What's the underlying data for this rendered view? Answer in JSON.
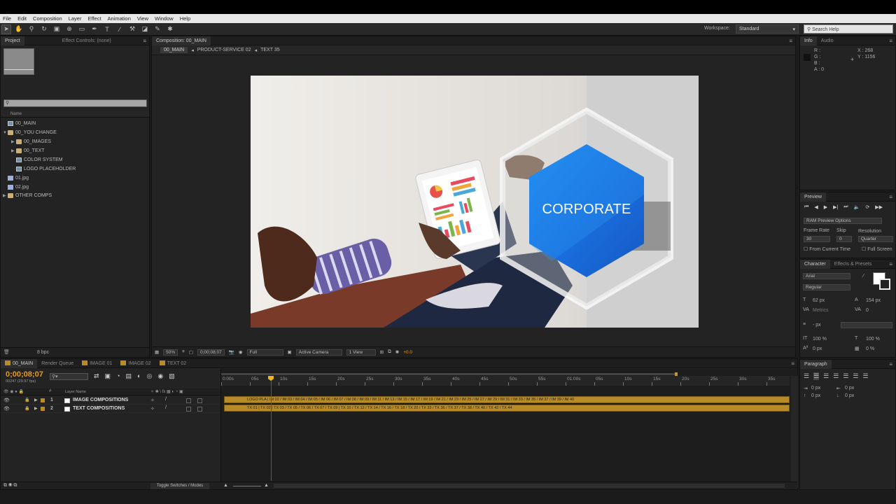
{
  "menu": [
    "File",
    "Edit",
    "Composition",
    "Layer",
    "Effect",
    "Animation",
    "View",
    "Window",
    "Help"
  ],
  "workspace": {
    "label": "Workspace:",
    "value": "Standard"
  },
  "search_help": "Search Help",
  "project": {
    "tabs": [
      "Project",
      "Effect Controls: (none)"
    ],
    "col_name": "Name",
    "items": [
      "00_MAIN",
      "00_YOU CHANGE",
      "00_IMAGES",
      "00_TEXT",
      "COLOR SYSTEM",
      "LOGO PLACEHOLDER",
      "01.jpg",
      "02.jpg",
      "OTHER COMPS"
    ],
    "bpc": "8 bpc"
  },
  "viewer": {
    "tab": "Composition: 00_MAIN",
    "crumbs": [
      "00_MAIN",
      "PRODUCT-SERVICE 02",
      "TEXT 35"
    ],
    "headline": "CORPORATE",
    "zoom": "50%",
    "timecode": "0;00;08;07",
    "resolution": "Full",
    "camera": "Active Camera",
    "views": "1 View",
    "exposure": "+0.0"
  },
  "info": {
    "tabs": [
      "Info",
      "Audio"
    ],
    "r": "R :",
    "g": "G :",
    "b": "B :",
    "a": "A : 0",
    "x": "X : 268",
    "y": "Y : 1156"
  },
  "preview": {
    "tab": "Preview",
    "ram": "RAM Preview Options",
    "frame_rate_label": "Frame Rate",
    "skip_label": "Skip",
    "resolution_label": "Resolution",
    "frame_rate": "30",
    "skip": "0",
    "resolution": "Quarter",
    "from_current": "From Current Time",
    "full_screen": "Full Screen"
  },
  "character": {
    "tabs": [
      "Character",
      "Effects & Presets"
    ],
    "font": "Arial",
    "style": "Regular",
    "size": "62 px",
    "leading": "154 px",
    "kerning": "Metrics",
    "tracking": "0",
    "stroke": "- px",
    "vscale": "100 %",
    "hscale": "100 %",
    "baseline": "0 px",
    "tsume": "0 %"
  },
  "paragraph": {
    "tab": "Paragraph",
    "indent1": "0 px",
    "indent2": "0 px",
    "indent3": "0 px",
    "space1": "0 px",
    "space2": "0 px"
  },
  "timeline": {
    "tabs": [
      "00_MAIN",
      "Render Queue",
      "IMAGE 01",
      "IMAGE 02",
      "TEXT 02"
    ],
    "timecode": "0;00;08;07",
    "fps": "00247 (29.97 fps)",
    "col_layer": "Layer Name",
    "layers": [
      {
        "num": "1",
        "name": "IMAGE COMPOSITIONS"
      },
      {
        "num": "2",
        "name": "TEXT COMPOSITIONS"
      }
    ],
    "ticks": [
      "0:00s",
      "05s",
      "10s",
      "15s",
      "20s",
      "25s",
      "30s",
      "35s",
      "40s",
      "45s",
      "50s",
      "55s",
      "01:00s",
      "05s",
      "10s",
      "15s",
      "20s",
      "25s",
      "30s",
      "35s"
    ],
    "toggle": "Toggle Switches / Modes",
    "track1": "LOGO PLA | IM 02 / IM 03 / IM 04 / IM 05 / IM 06 / IM 07 / IM 08 / IM 09 / IM 11 / IM 13 / IM 15 / IM 17 / IM 19 / IM 21 / IM 23 / IM 25 / IM 27 / IM 29 / IM 31 / IM 33 / IM 35 / IM 37 / IM 39 / IM 40",
    "track2": "TX 01 | TX 02 | TX 03 / TX 05 / TX 06 / TX 07 / TX 09 | TX 10 / TX 12 / TX 14 / TX 16 / TX 18 / TX 20 / TX 33 / TX 36 / TX 37 / TX 38 / TX 40 / TX 42 / TX 44"
  },
  "colors": {
    "accent": "#e89a1e",
    "hexagon": "#1a6fe0",
    "track": "#b88a28"
  }
}
